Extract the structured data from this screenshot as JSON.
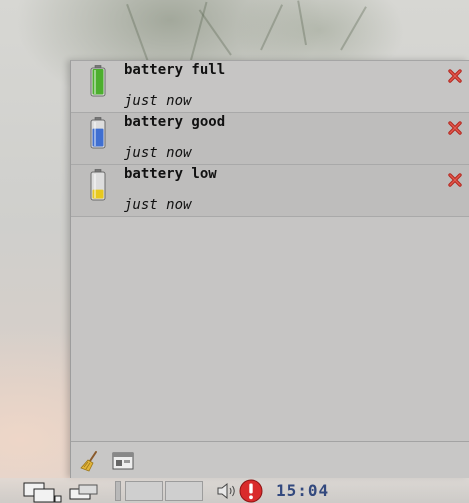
{
  "notifications": [
    {
      "title": "battery full",
      "time": "just now",
      "icon": "battery-full-icon",
      "level_color": "#4caf2e",
      "level": 1.0
    },
    {
      "title": "battery good",
      "time": "just now",
      "icon": "battery-good-icon",
      "level_color": "#3f6fd1",
      "level": 0.7
    },
    {
      "title": "battery low",
      "time": "just now",
      "icon": "battery-low-icon",
      "level_color": "#e8c91e",
      "level": 0.35
    }
  ],
  "footer": {
    "clear_icon": "broom-icon",
    "settings_icon": "window-settings-icon"
  },
  "taskbar": {
    "clock": "15:04",
    "volume_icon": "speaker-icon",
    "alert_icon": "warning-icon",
    "alert_color": "#d92b2b"
  }
}
